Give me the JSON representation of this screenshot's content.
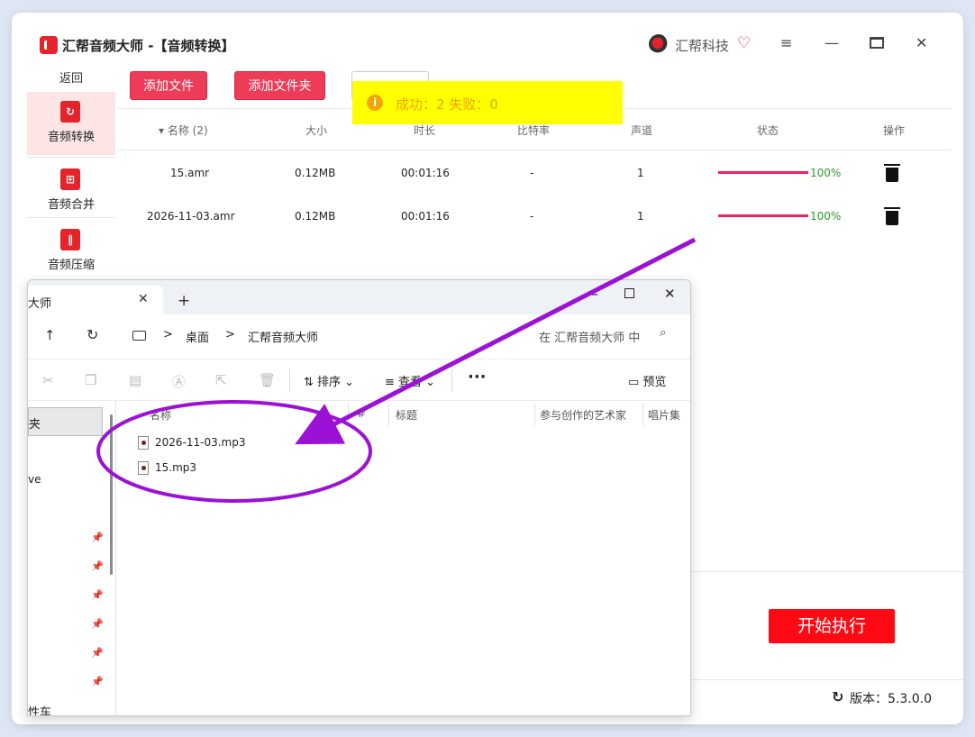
{
  "app": {
    "title": "汇帮音频大师 -【音频转换】",
    "brand": "汇帮科技",
    "menu_glyph": "≡",
    "min_glyph": "—",
    "close_glyph": "✕"
  },
  "sidebar": {
    "back_label": "返回",
    "items": [
      {
        "label": "音频转换",
        "icon": "convert-icon",
        "active": true
      },
      {
        "label": "音频合并",
        "icon": "merge-icon",
        "active": false
      },
      {
        "label": "音频压缩",
        "icon": "compress-icon",
        "active": false
      }
    ]
  },
  "toolbar": {
    "add_file": "添加文件",
    "add_folder": "添加文件夹"
  },
  "toast": {
    "icon": "i",
    "text": "成功：2    失败：0",
    "color": "#ffff00"
  },
  "table": {
    "headers": [
      "▾ 名称 (2)",
      "大小",
      "时长",
      "比特率",
      "声道",
      "状态",
      "操作"
    ],
    "rows": [
      {
        "name": "15.amr",
        "size": "0.12MB",
        "duration": "00:01:16",
        "bitrate": "-",
        "channels": "1",
        "progress": "100%"
      },
      {
        "name": "2026-11-03.amr",
        "size": "0.12MB",
        "duration": "00:01:16",
        "bitrate": "-",
        "channels": "1",
        "progress": "100%"
      }
    ]
  },
  "footer": {
    "start_button": "开始执行",
    "version": "版本：5.3.0.0"
  },
  "explorer": {
    "tab_title": "大师",
    "tab_close": "✕",
    "new_tab": "+",
    "win_min": "—",
    "win_close": "✕",
    "up_glyph": "↑",
    "refresh_glyph": "↻",
    "breadcrumbs": [
      "桌面",
      "汇帮音频大师"
    ],
    "crumb_sep": ">",
    "search_placeholder": "在 汇帮音频大师 中",
    "search_glyph": "⌕",
    "commands": {
      "sort": "⇅ 排序 ⌄",
      "view": "≡ 查看 ⌄",
      "more": "···",
      "preview": "▭ 预览"
    },
    "nav": {
      "selected": "夹",
      "item2": "ve",
      "bottom": "性车"
    },
    "columns": [
      "名称",
      "#",
      "标题",
      "参与创作的艺术家",
      "唱片集"
    ],
    "files": [
      "2026-11-03.mp3",
      "15.mp3"
    ]
  }
}
